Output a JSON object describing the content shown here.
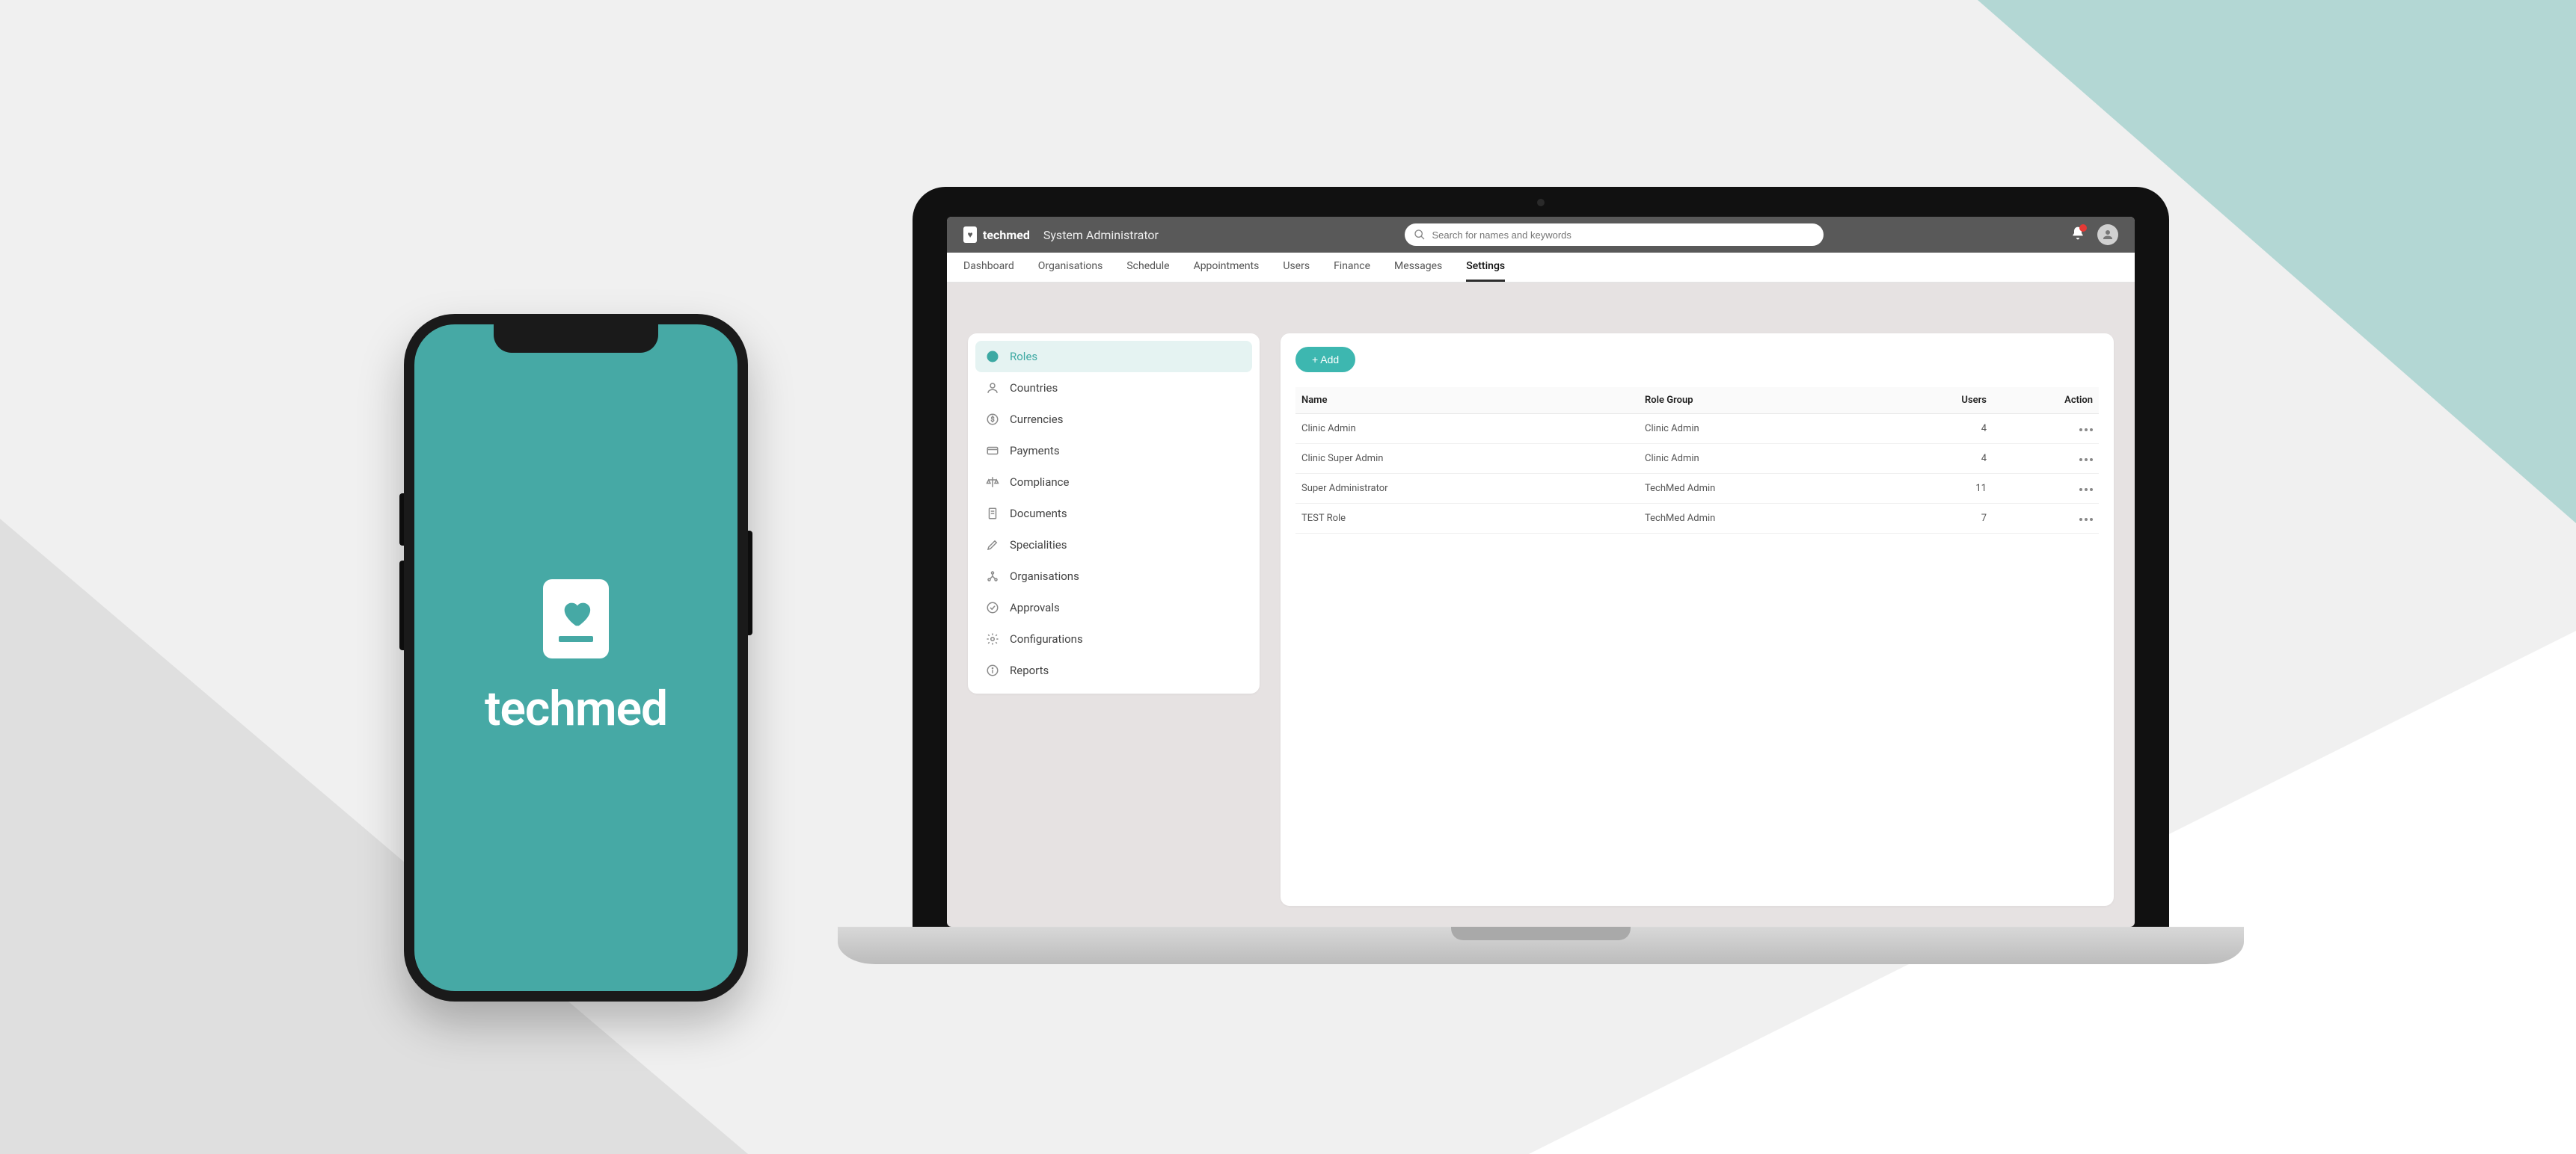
{
  "colors": {
    "teal": "#46a9a5",
    "accent": "#3db7b0"
  },
  "phone": {
    "brand": "techmed"
  },
  "header": {
    "brand": "techmed",
    "role": "System Administrator",
    "search_placeholder": "Search for names and keywords"
  },
  "tabs": {
    "items": [
      {
        "label": "Dashboard"
      },
      {
        "label": "Organisations"
      },
      {
        "label": "Schedule"
      },
      {
        "label": "Appointments"
      },
      {
        "label": "Users"
      },
      {
        "label": "Finance"
      },
      {
        "label": "Messages"
      },
      {
        "label": "Settings"
      }
    ],
    "active_index": 7
  },
  "sidebar": {
    "items": [
      {
        "label": "Roles",
        "icon": "globe-icon"
      },
      {
        "label": "Countries",
        "icon": "person-icon"
      },
      {
        "label": "Currencies",
        "icon": "currency-icon"
      },
      {
        "label": "Payments",
        "icon": "card-icon"
      },
      {
        "label": "Compliance",
        "icon": "balance-icon"
      },
      {
        "label": "Documents",
        "icon": "document-icon"
      },
      {
        "label": "Specialities",
        "icon": "pencil-icon"
      },
      {
        "label": "Organisations",
        "icon": "org-icon"
      },
      {
        "label": "Approvals",
        "icon": "check-circle-icon"
      },
      {
        "label": "Configurations",
        "icon": "gear-icon"
      },
      {
        "label": "Reports",
        "icon": "info-icon"
      }
    ],
    "active_index": 0
  },
  "main": {
    "add_label": "+ Add",
    "columns": {
      "name": "Name",
      "role_group": "Role Group",
      "users": "Users",
      "action": "Action"
    },
    "rows": [
      {
        "name": "Clinic Admin",
        "role_group": "Clinic Admin",
        "users": "4"
      },
      {
        "name": "Clinic Super Admin",
        "role_group": "Clinic Admin",
        "users": "4"
      },
      {
        "name": "Super Administrator",
        "role_group": "TechMed Admin",
        "users": "11"
      },
      {
        "name": "TEST Role",
        "role_group": "TechMed Admin",
        "users": "7"
      }
    ]
  }
}
